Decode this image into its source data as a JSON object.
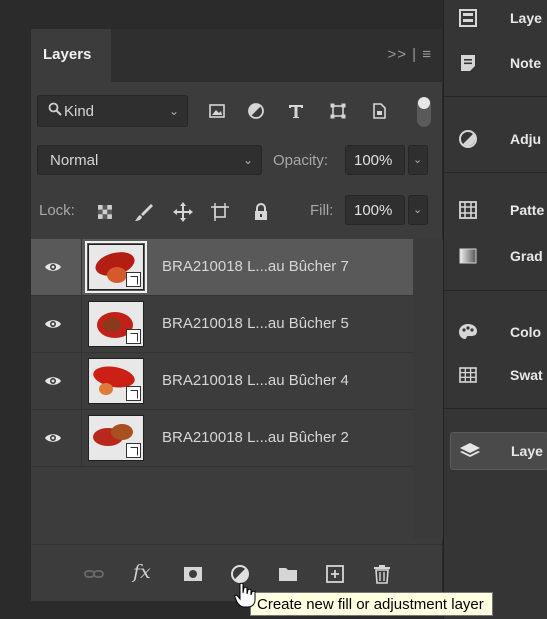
{
  "layers_panel": {
    "tab_title": "Layers",
    "tab_controls": ">> | ≡",
    "filter": {
      "kind_label": "Kind",
      "filter_icons": [
        "image-filter-icon",
        "adjustment-filter-icon",
        "type-filter-icon",
        "shape-filter-icon",
        "smart-object-filter-icon"
      ]
    },
    "blend_mode": "Normal",
    "opacity_label": "Opacity:",
    "opacity_value": "100%",
    "lock_label": "Lock:",
    "fill_label": "Fill:",
    "fill_value": "100%",
    "layers": [
      {
        "name": "BRA210018 L...au Bûcher 7",
        "selected": true,
        "visible": true
      },
      {
        "name": "BRA210018 L...au Bûcher 5",
        "selected": false,
        "visible": true
      },
      {
        "name": "BRA210018 L...au Bûcher 4",
        "selected": false,
        "visible": true
      },
      {
        "name": "BRA210018 L...au Bûcher 2",
        "selected": false,
        "visible": true
      }
    ],
    "bottom_icons": [
      "link-layers-icon",
      "fx-icon",
      "add-mask-icon",
      "new-fill-adjustment-icon",
      "new-group-icon",
      "new-layer-icon",
      "delete-layer-icon"
    ],
    "fx_label": "fx"
  },
  "dock": {
    "items": [
      {
        "label": "Laye",
        "icon": "layers-alt-icon"
      },
      {
        "label": "Note",
        "icon": "notes-icon"
      },
      {
        "label": "Adju",
        "icon": "adjustments-icon"
      },
      {
        "label": "Patte",
        "icon": "patterns-icon"
      },
      {
        "label": "Grad",
        "icon": "gradients-icon"
      },
      {
        "label": "Colo",
        "icon": "color-icon"
      },
      {
        "label": "Swat",
        "icon": "swatches-icon"
      },
      {
        "label": "Laye",
        "icon": "layers-icon",
        "active": true
      }
    ]
  },
  "tooltip": "Create new fill or adjustment layer",
  "colors": {
    "panel_bg": "#3c3c3c",
    "selected_row": "#595959",
    "tooltip_bg": "#ffffe1"
  }
}
